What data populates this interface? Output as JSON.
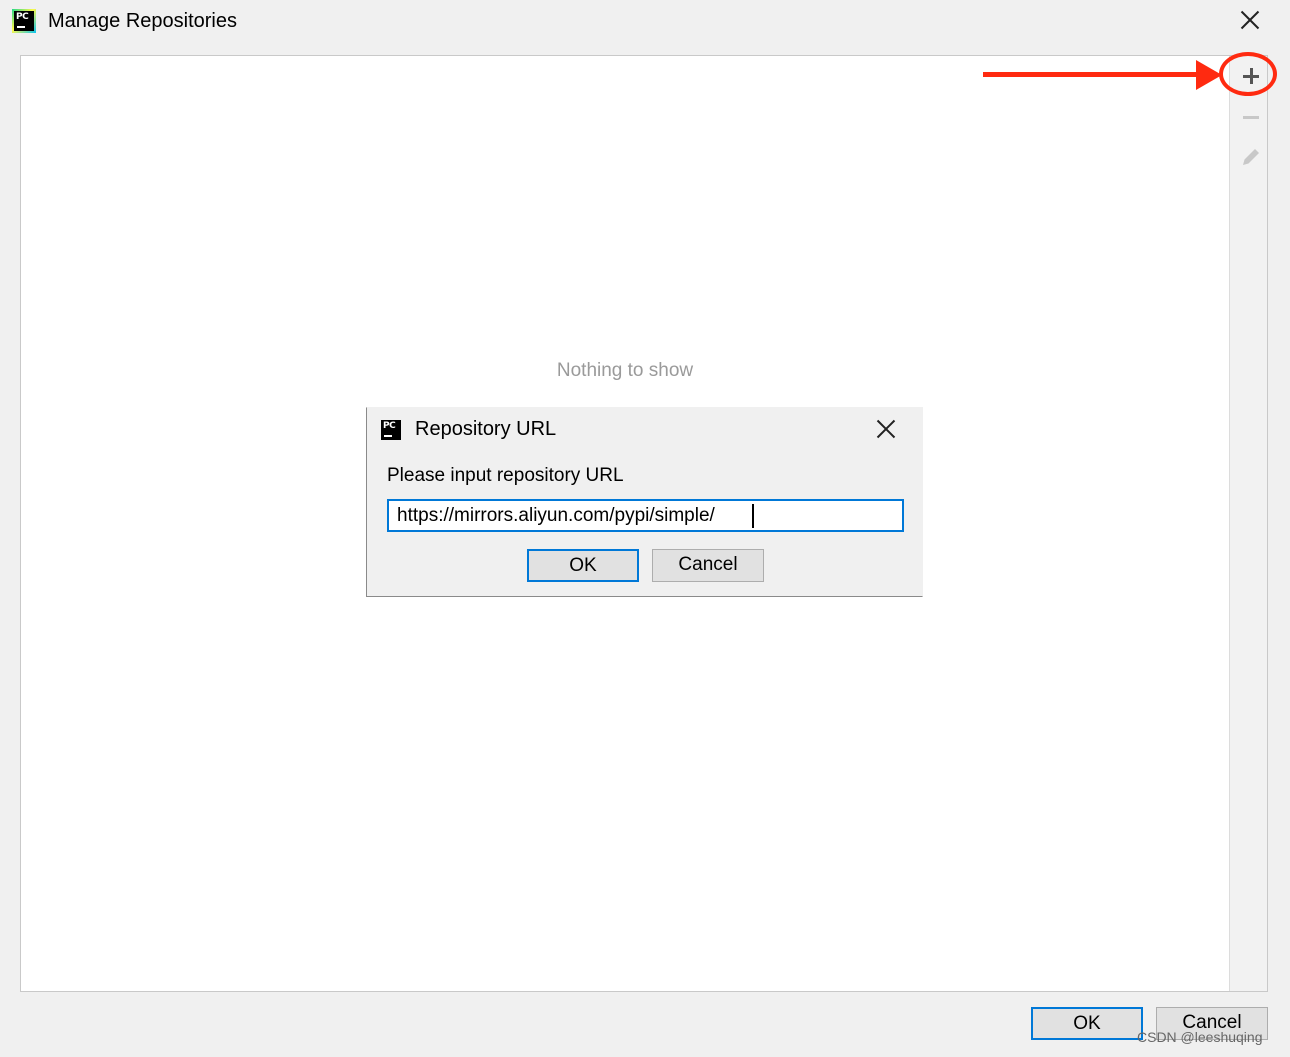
{
  "window": {
    "title": "Manage Repositories",
    "icon": "pycharm-logo-icon",
    "logo_text": "PC"
  },
  "panel": {
    "empty_text": "Nothing to show",
    "toolbar": [
      {
        "name": "add-icon",
        "tooltip": "",
        "enabled": true
      },
      {
        "name": "remove-icon",
        "tooltip": "",
        "enabled": false
      },
      {
        "name": "edit-icon",
        "tooltip": "",
        "enabled": false
      }
    ]
  },
  "dialog": {
    "title": "Repository URL",
    "icon": "pycharm-logo-icon",
    "logo_text": "PC",
    "label": "Please input repository URL",
    "input_value": "https://mirrors.aliyun.com/pypi/simple/",
    "ok_label": "OK",
    "cancel_label": "Cancel"
  },
  "footer": {
    "ok_label": "OK",
    "cancel_label": "Cancel"
  },
  "annotation": {
    "color": "#ff2a10"
  },
  "colors": {
    "focus_border": "#0078d7",
    "window_bg": "#f0f0f0"
  },
  "watermark": "CSDN @leeshuqing"
}
